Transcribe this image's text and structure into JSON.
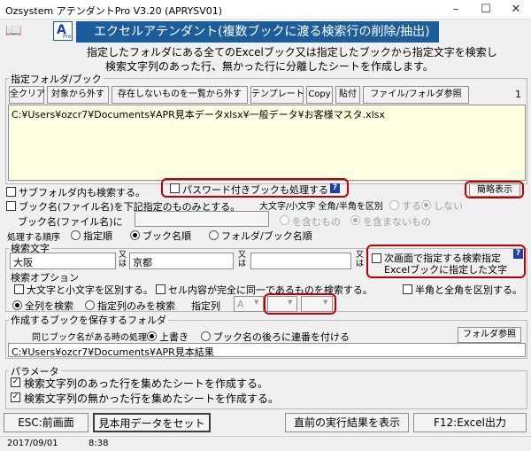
{
  "window": {
    "title": "Ozsystem アテンダントPro V3.20 (APRYSV01)"
  },
  "banner": {
    "title": "エクセルアテンダント(複数ブックに渡る検索行の削除/抽出)"
  },
  "description": {
    "line1": "指定したフォルダにある全てのExcelブック又は指定したブックから指定文字を検索し",
    "line2": "検索文字列のあった行、無かった行に分離したシートを作成します。"
  },
  "folder_section": {
    "label": "指定フォルダ/ブック",
    "buttons": [
      "全クリア",
      "対象から外す",
      "存在しないものを一覧から外す",
      "テンプレート",
      "Copy",
      "貼付",
      "ファイル/フォルダ参照"
    ],
    "count": "1",
    "path": "C:¥Users¥ozcr7¥Documents¥APR見本データxlsx¥一般データ¥お客様マスタ.xlsx"
  },
  "options": {
    "subfolder": "サブフォルダ内も検索する。",
    "password": "パスワード付きブックも処理する",
    "brief_button": "簡略表示",
    "bookname_only": "ブック名(ファイル名)を下記指定のものみとする。",
    "case_label": "大文字/小文字 全角/半角を区別",
    "case_yes": "する",
    "case_no": "しない",
    "bookname_in": "ブック名(ファイル名)に",
    "contains": "を含むもの",
    "not_contains": "を含まないもの",
    "order_label": "処理する順序",
    "order_spec": "指定順",
    "order_book": "ブック名順",
    "order_folder": "フォルダ/ブック名順"
  },
  "search": {
    "label": "検索文字",
    "term1": "大阪",
    "term2": "京都",
    "term3": "",
    "or1": "又\nは",
    "or2": "又\nは",
    "or3": "又\nは",
    "next_screen_line1": "次画面で指定する検索指定",
    "next_screen_line2": "Excelブックに指定した文字",
    "options_label": "検索オプション",
    "case_sensitive": "大文字と小文字を区別する。",
    "exact_match": "セル内容が完全に同一であるものを検索する。",
    "width_sensitive": "半角と全角を区別する。",
    "all_columns": "全列を検索",
    "spec_columns": "指定列のみを検索",
    "col_label": "指定列",
    "col_value": "A"
  },
  "save": {
    "label": "作成するブックを保存するフォルダ",
    "same_name_label": "同じブック名がある時の処理",
    "overwrite": "上書き",
    "append": "ブック名の後ろに連番を付ける",
    "folder_button": "フォルダ参照",
    "path": "C:¥Users¥ozcr7¥Documents¥APR見本結果"
  },
  "params": {
    "label": "パラメータ",
    "with_rows": "検索文字列のあった行を集めたシートを作成する。",
    "without_rows": "検索文字列の無かった行を集めたシートを作成する。"
  },
  "footer": {
    "esc": "ESC:前画面",
    "sample": "見本用データをセット",
    "prev_result": "直前の実行結果を表示",
    "f12": "F12:Excel出力"
  },
  "status": {
    "date": "2017/09/01",
    "time": "8:38"
  },
  "colors": {
    "banner": "#1c5d9c",
    "highlight": "#c00000",
    "path_bg": "#ffffe1"
  }
}
